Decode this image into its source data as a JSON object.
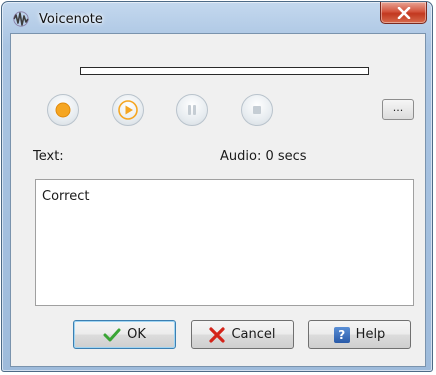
{
  "window": {
    "title": "Voicenote",
    "close_symbol": "x"
  },
  "progress": {
    "value": 0
  },
  "controls": {
    "record_icon": "record-icon",
    "play_icon": "play-icon",
    "pause_icon": "pause-icon",
    "stop_icon": "stop-icon",
    "more_label": "..."
  },
  "labels": {
    "text": "Text:",
    "audio": "Audio:  0 secs"
  },
  "text_field": {
    "value": "Correct"
  },
  "buttons": {
    "ok": "OK",
    "cancel": "Cancel",
    "help": "Help",
    "help_symbol": "?"
  },
  "colors": {
    "accent_orange": "#f5a623",
    "ok_check": "#3aa535",
    "cancel_x": "#d4241a"
  }
}
